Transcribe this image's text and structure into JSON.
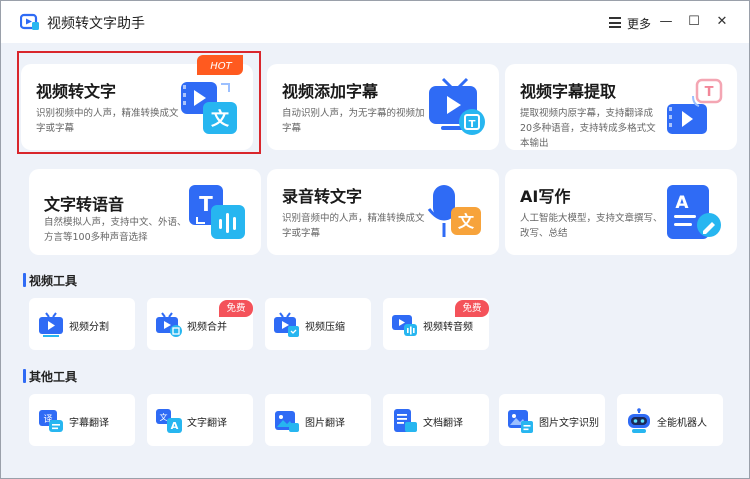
{
  "app": {
    "title": "视频转文字助手",
    "more_label": "更多",
    "minimize": "—",
    "maximize": "☐",
    "close": "✕"
  },
  "feature_cards": [
    {
      "title": "视频转文字",
      "desc": "识别视频中的人声，精准转换成文字或字幕",
      "icon": "video-to-text-icon",
      "badge": "HOT",
      "selected": true
    },
    {
      "title": "视频添加字幕",
      "desc": "自动识别人声，为无字幕的视频加字幕",
      "icon": "tv-subtitle-icon"
    },
    {
      "title": "视频字幕提取",
      "desc": "提取视频内原字幕，支持翻译成20多种语音，支持转成多格式文本输出",
      "icon": "subtitle-extract-icon"
    },
    {
      "title": "文字转语音",
      "desc": "自然模拟人声，支持中文、外语、方言等100多种声音选择",
      "icon": "text-to-speech-icon"
    },
    {
      "title": "录音转文字",
      "desc": "识别音频中的人声，精准转换成文字或字幕",
      "icon": "microphone-text-icon"
    },
    {
      "title": "AI写作",
      "desc": "人工智能大模型，支持文章撰写、改写、总结",
      "icon": "ai-writing-icon"
    }
  ],
  "sections": {
    "video_tools": "视频工具",
    "other_tools": "其他工具"
  },
  "video_tools": [
    {
      "label": "视频分割",
      "icon": "video-split-icon"
    },
    {
      "label": "视频合并",
      "icon": "video-merge-icon",
      "badge": "免费"
    },
    {
      "label": "视频压缩",
      "icon": "video-compress-icon"
    },
    {
      "label": "视频转音频",
      "icon": "video-to-audio-icon",
      "badge": "免费"
    }
  ],
  "other_tools": [
    {
      "label": "字幕翻译",
      "icon": "subtitle-translate-icon"
    },
    {
      "label": "文字翻译",
      "icon": "text-translate-icon"
    },
    {
      "label": "图片翻译",
      "icon": "image-translate-icon"
    },
    {
      "label": "文档翻译",
      "icon": "document-translate-icon"
    },
    {
      "label": "图片文字识别",
      "icon": "image-ocr-icon"
    },
    {
      "label": "全能机器人",
      "icon": "robot-icon"
    }
  ],
  "colors": {
    "accent": "#2f6bf5",
    "cyan": "#27b6f0",
    "hot": "#ff5a1f",
    "free": "#f4525a",
    "selected_border": "#d9262c",
    "background": "#eef2f9"
  }
}
